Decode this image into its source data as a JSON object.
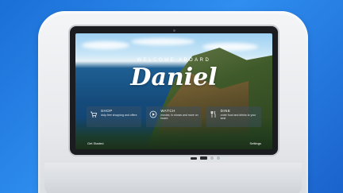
{
  "screen": {
    "welcome_text": "WELCOME ABOARD",
    "passenger_name": "Daniel",
    "tiles": [
      {
        "title": "SHOP",
        "description": "duty-free shopping and offers",
        "icon": "cart-icon"
      },
      {
        "title": "WATCH",
        "description": "movies, tv shows and more on board",
        "icon": "play-icon"
      },
      {
        "title": "DINE",
        "description": "order food and drinks to your seat",
        "icon": "cutlery-icon"
      }
    ],
    "footer_left": "Get Started",
    "footer_right": "Settings"
  },
  "colors": {
    "background": "#2f8ef0",
    "bezel": "#1a1c20",
    "seat": "#e7e9ec"
  }
}
